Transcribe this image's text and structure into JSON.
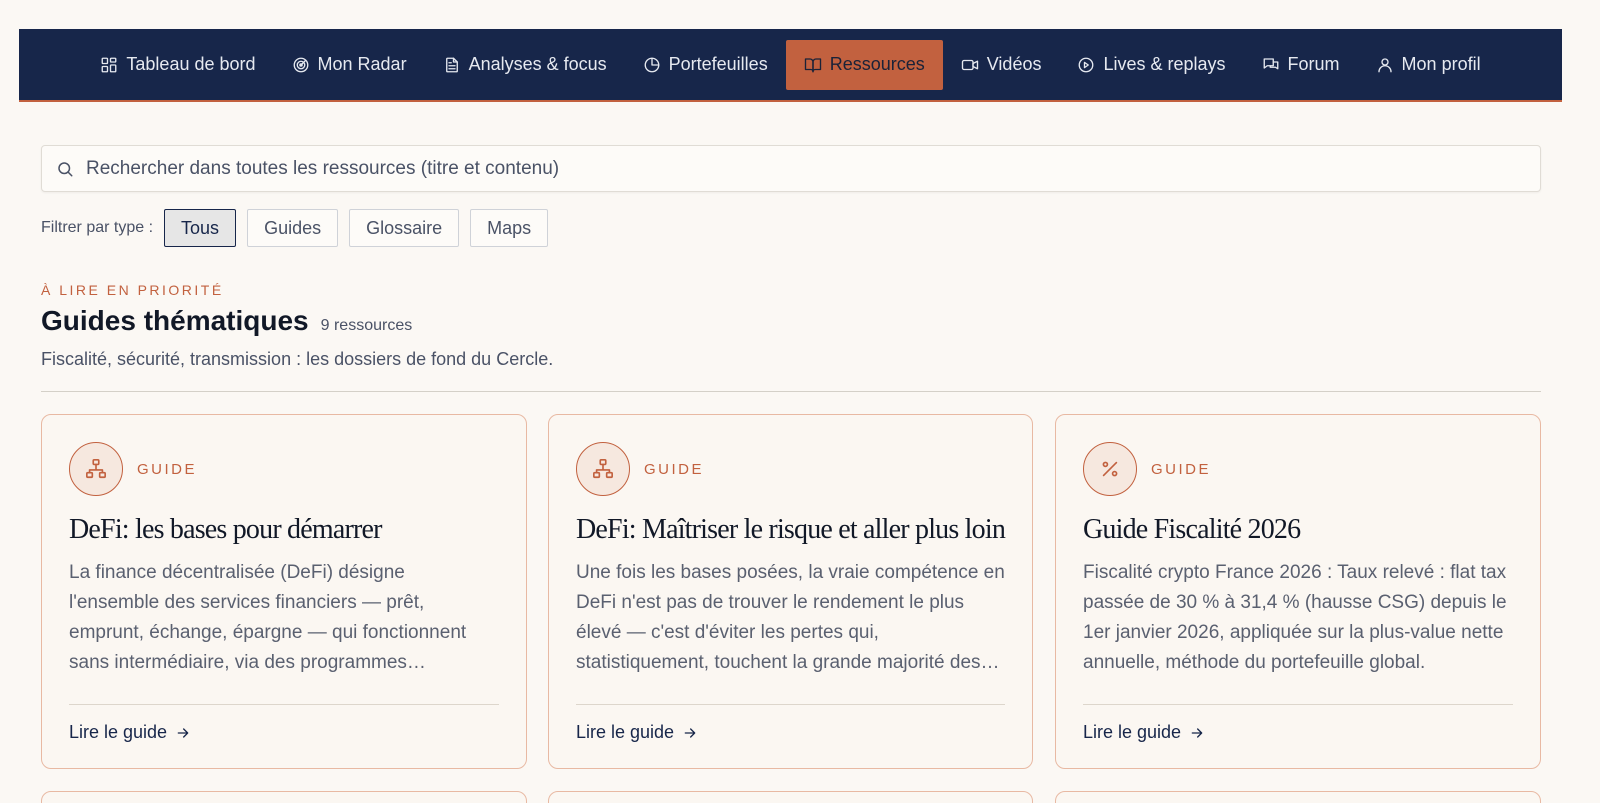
{
  "nav": {
    "items": [
      {
        "label": "Tableau de bord",
        "icon": "dashboard-icon",
        "active": false
      },
      {
        "label": "Mon Radar",
        "icon": "radar-icon",
        "active": false
      },
      {
        "label": "Analyses & focus",
        "icon": "document-icon",
        "active": false
      },
      {
        "label": "Portefeuilles",
        "icon": "pie-chart-icon",
        "active": false
      },
      {
        "label": "Ressources",
        "icon": "book-icon",
        "active": true
      },
      {
        "label": "Vidéos",
        "icon": "video-icon",
        "active": false
      },
      {
        "label": "Lives & replays",
        "icon": "play-circle-icon",
        "active": false
      },
      {
        "label": "Forum",
        "icon": "chat-icon",
        "active": false
      },
      {
        "label": "Mon profil",
        "icon": "user-icon",
        "active": false
      }
    ]
  },
  "search": {
    "placeholder": "Rechercher dans toutes les ressources (titre et contenu)",
    "value": ""
  },
  "filters": {
    "label": "Filtrer par type :",
    "options": [
      "Tous",
      "Guides",
      "Glossaire",
      "Maps"
    ],
    "selected": "Tous"
  },
  "section": {
    "eyebrow": "À LIRE EN PRIORITÉ",
    "title": "Guides thématiques",
    "count": "9 ressources",
    "description": "Fiscalité, sécurité, transmission : les dossiers de fond du Cercle."
  },
  "cards": [
    {
      "type": "GUIDE",
      "icon": "network-icon",
      "title": "DeFi: les bases pour démarrer",
      "excerpt": "La finance décentralisée (DeFi) désigne l'ensemble des services financiers — prêt, emprunt, échange, épargne — qui fonctionnent sans intermédiaire, via des programmes informatiques autonomes.",
      "link": "Lire le guide"
    },
    {
      "type": "GUIDE",
      "icon": "network-icon",
      "title": "DeFi: Maîtriser le risque et aller plus loin",
      "excerpt": "Une fois les bases posées, la vraie compétence en DeFi n'est pas de trouver le rendement le plus élevé — c'est d'éviter les pertes qui, statistiquement, touchent la grande majorité des utilisateurs.",
      "link": "Lire le guide"
    },
    {
      "type": "GUIDE",
      "icon": "percent-icon",
      "title": "Guide Fiscalité 2026",
      "excerpt": "Fiscalité crypto France 2026 : Taux relevé : flat tax passée de 30 % à 31,4 % (hausse CSG) depuis le 1er janvier 2026, appliquée sur la plus-value nette annuelle, méthode du portefeuille global.",
      "link": "Lire le guide"
    }
  ]
}
